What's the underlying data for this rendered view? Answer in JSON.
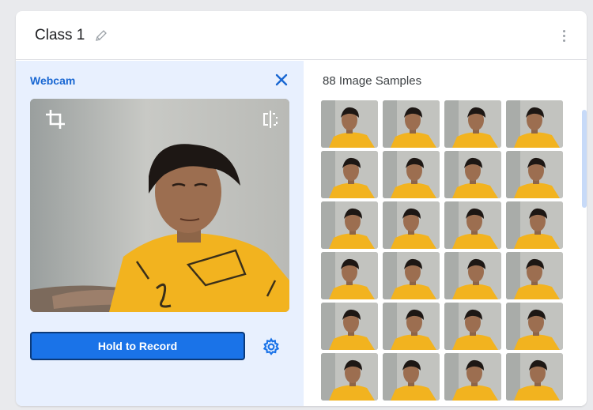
{
  "class_card": {
    "title": "Class 1",
    "edit_icon": "pencil-icon",
    "menu_icon": "kebab-menu-icon"
  },
  "webcam": {
    "label": "Webcam",
    "close_icon": "close-icon",
    "crop_icon": "crop-icon",
    "flip_icon": "flip-icon",
    "record_label": "Hold to Record",
    "settings_icon": "gear-icon"
  },
  "samples": {
    "label": "88 Image Samples",
    "visible_thumbnails": 24
  },
  "colors": {
    "accent": "#1a73e8",
    "webcam_label": "#1967d2",
    "left_panel_bg": "#e8f0fe",
    "shirt": "#f2b31f"
  }
}
